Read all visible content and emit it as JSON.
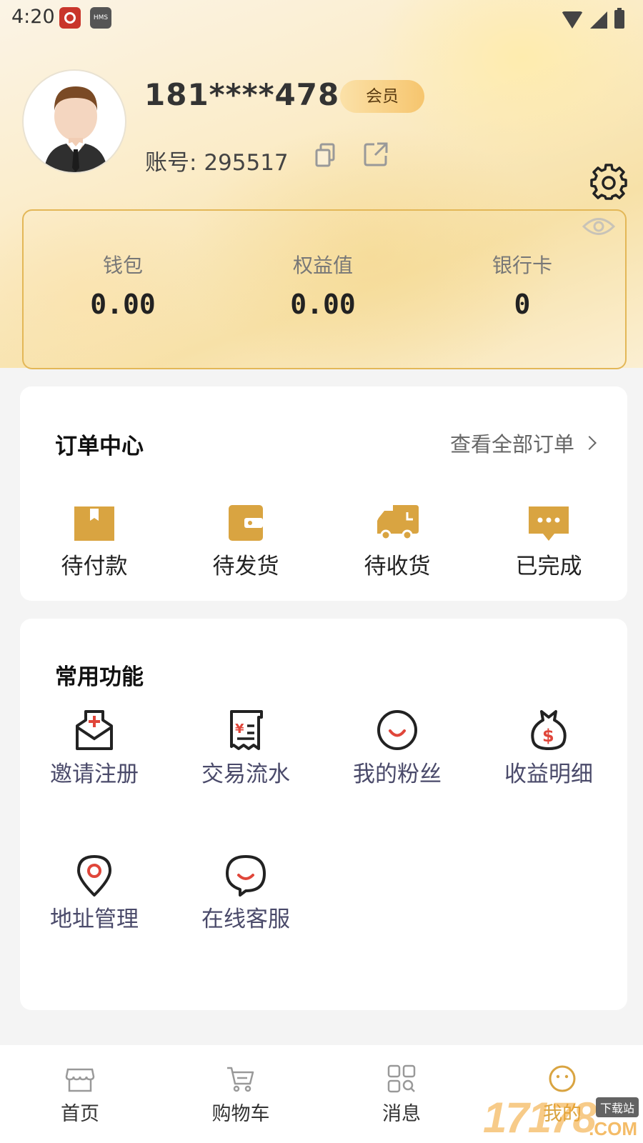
{
  "status_bar": {
    "time": "4:20",
    "app_badge": "HMS"
  },
  "profile": {
    "phone": "181****4786",
    "badge": "会员",
    "account_label": "账号:",
    "account_number": "295517"
  },
  "balances": [
    {
      "label": "钱包",
      "value": "0.00"
    },
    {
      "label": "权益值",
      "value": "0.00"
    },
    {
      "label": "银行卡",
      "value": "0"
    }
  ],
  "orders": {
    "title": "订单中心",
    "view_all": "查看全部订单",
    "items": [
      {
        "label": "待付款",
        "icon": "box-icon"
      },
      {
        "label": "待发货",
        "icon": "wallet-icon"
      },
      {
        "label": "待收货",
        "icon": "truck-icon"
      },
      {
        "label": "已完成",
        "icon": "chat-icon"
      }
    ]
  },
  "features": {
    "title": "常用功能",
    "items": [
      {
        "label": "邀请注册",
        "icon": "invite-mail-icon"
      },
      {
        "label": "交易流水",
        "icon": "receipt-icon"
      },
      {
        "label": "我的粉丝",
        "icon": "smile-icon"
      },
      {
        "label": "收益明细",
        "icon": "money-bag-icon"
      },
      {
        "label": "地址管理",
        "icon": "location-pin-icon"
      },
      {
        "label": "在线客服",
        "icon": "service-chat-icon"
      }
    ]
  },
  "bottom_nav": [
    {
      "label": "首页",
      "icon": "store-icon"
    },
    {
      "label": "购物车",
      "icon": "cart-icon"
    },
    {
      "label": "消息",
      "icon": "grid-icon"
    },
    {
      "label": "我的",
      "icon": "profile-smile-icon",
      "active": true
    }
  ],
  "watermark": {
    "text": "17178",
    "tag": "下载站",
    "suffix": ".COM"
  },
  "colors": {
    "accent": "#d9a441",
    "icon_gold": "#d9a441",
    "icon_red": "#e0463a"
  }
}
